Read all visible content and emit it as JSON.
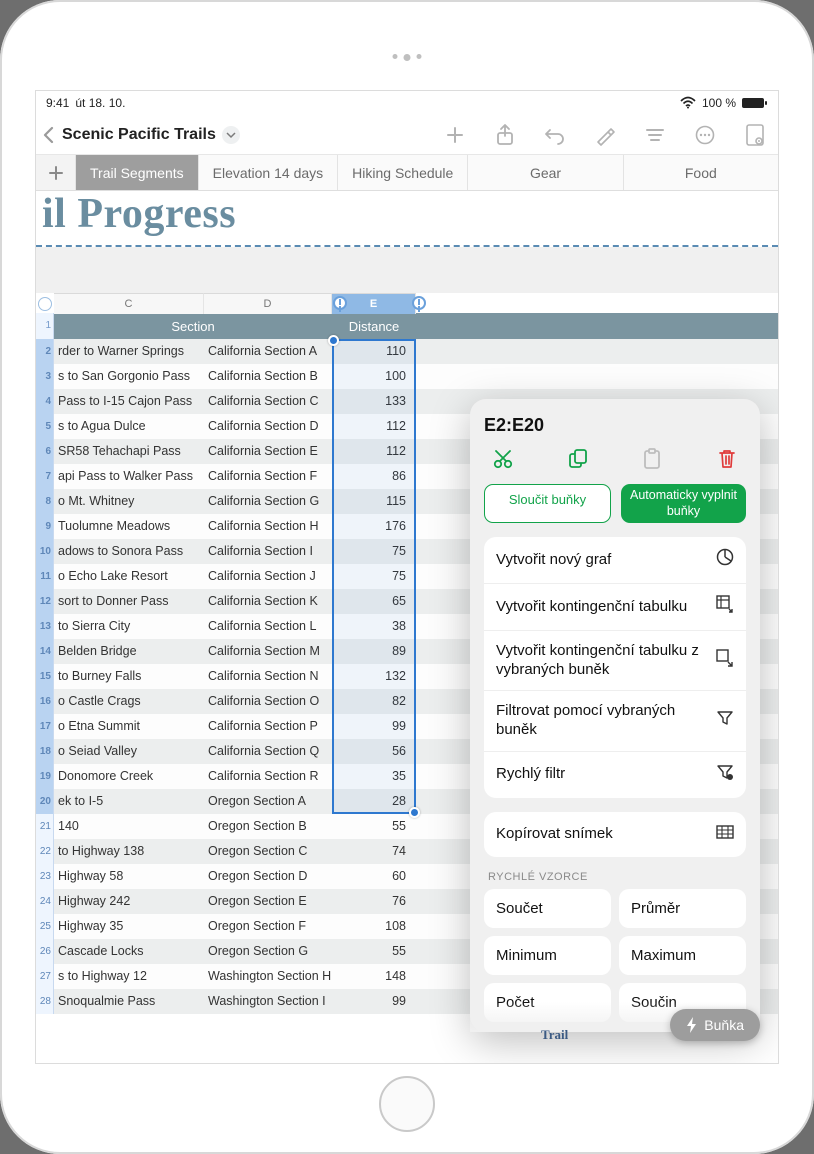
{
  "status": {
    "time": "9:41",
    "date": "út 18. 10.",
    "battery": "100 %"
  },
  "toolbar": {
    "title": "Scenic Pacific Trails"
  },
  "tabs": [
    "Trail Segments",
    "Elevation 14 days",
    "Hiking Schedule",
    "Gear",
    "Food"
  ],
  "hero": "il Progress",
  "columns": {
    "c": "C",
    "d": "D",
    "e": "E"
  },
  "header": {
    "section": "Section",
    "distance": "Distance"
  },
  "rows": [
    {
      "n": 2,
      "c1": "rder to Warner Springs",
      "c2": "California Section A",
      "c3": "110"
    },
    {
      "n": 3,
      "c1": "s to San Gorgonio Pass",
      "c2": "California Section B",
      "c3": "100"
    },
    {
      "n": 4,
      "c1": "Pass to I-15 Cajon Pass",
      "c2": "California Section C",
      "c3": "133"
    },
    {
      "n": 5,
      "c1": "s to Agua Dulce",
      "c2": "California Section D",
      "c3": "112"
    },
    {
      "n": 6,
      "c1": "SR58 Tehachapi Pass",
      "c2": "California Section E",
      "c3": "112"
    },
    {
      "n": 7,
      "c1": "api Pass to Walker Pass",
      "c2": "California Section F",
      "c3": "86"
    },
    {
      "n": 8,
      "c1": "o Mt. Whitney",
      "c2": "California Section G",
      "c3": "115"
    },
    {
      "n": 9,
      "c1": "Tuolumne Meadows",
      "c2": "California Section H",
      "c3": "176"
    },
    {
      "n": 10,
      "c1": "adows to Sonora Pass",
      "c2": "California Section I",
      "c3": "75"
    },
    {
      "n": 11,
      "c1": "o Echo Lake Resort",
      "c2": "California Section J",
      "c3": "75"
    },
    {
      "n": 12,
      "c1": "sort to Donner Pass",
      "c2": "California Section K",
      "c3": "65"
    },
    {
      "n": 13,
      "c1": "to Sierra City",
      "c2": "California Section L",
      "c3": "38"
    },
    {
      "n": 14,
      "c1": "Belden Bridge",
      "c2": "California Section M",
      "c3": "89"
    },
    {
      "n": 15,
      "c1": "to Burney Falls",
      "c2": "California Section N",
      "c3": "132"
    },
    {
      "n": 16,
      "c1": "o Castle Crags",
      "c2": "California Section O",
      "c3": "82"
    },
    {
      "n": 17,
      "c1": "o Etna Summit",
      "c2": "California Section P",
      "c3": "99"
    },
    {
      "n": 18,
      "c1": "o Seiad Valley",
      "c2": "California Section Q",
      "c3": "56"
    },
    {
      "n": 19,
      "c1": "Donomore Creek",
      "c2": "California Section R",
      "c3": "35"
    },
    {
      "n": 20,
      "c1": "ek to I-5",
      "c2": "Oregon Section A",
      "c3": "28"
    },
    {
      "n": 21,
      "c1": "140",
      "c2": "Oregon Section B",
      "c3": "55"
    },
    {
      "n": 22,
      "c1": "to Highway 138",
      "c2": "Oregon Section C",
      "c3": "74"
    },
    {
      "n": 23,
      "c1": "Highway 58",
      "c2": "Oregon Section D",
      "c3": "60"
    },
    {
      "n": 24,
      "c1": "Highway 242",
      "c2": "Oregon Section E",
      "c3": "76"
    },
    {
      "n": 25,
      "c1": "Highway 35",
      "c2": "Oregon Section F",
      "c3": "108"
    },
    {
      "n": 26,
      "c1": "Cascade Locks",
      "c2": "Oregon Section G",
      "c3": "55"
    },
    {
      "n": 27,
      "c1": "s to Highway 12",
      "c2": "Washington Section H",
      "c3": "148"
    },
    {
      "n": 28,
      "c1": "Snoqualmie Pass",
      "c2": "Washington Section I",
      "c3": "99"
    }
  ],
  "selRowStart": 2,
  "selRowEnd": 20,
  "pop": {
    "range": "E2:E20",
    "merge": "Sloučit buňky",
    "autofill": "Automaticky vyplnit buňky",
    "items": [
      "Vytvořit nový graf",
      "Vytvořit kontingenční tabulku",
      "Vytvořit kontingenční tabulku z vybraných buněk",
      "Filtrovat pomocí vybraných buněk",
      "Rychlý filtr"
    ],
    "copy": "Kopírovat snímek",
    "section": "RYCHLÉ VZORCE",
    "formulas": [
      "Součet",
      "Průměr",
      "Minimum",
      "Maximum",
      "Počet",
      "Součin"
    ]
  },
  "cellbtn": "Buňka",
  "trail": "Trail"
}
